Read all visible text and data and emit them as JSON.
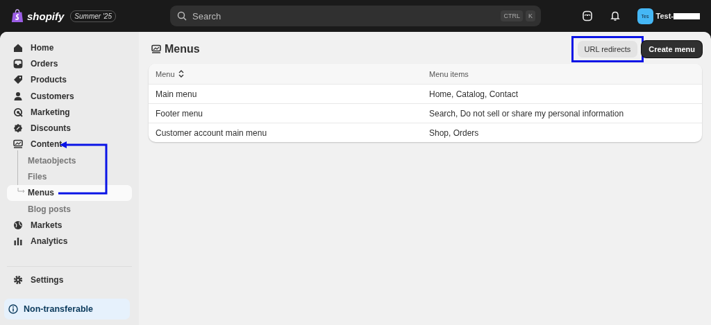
{
  "topbar": {
    "brand": "shopify",
    "edition": "Summer '25",
    "search": {
      "placeholder": "Search",
      "shortcut": [
        "CTRL",
        "K"
      ]
    },
    "avatar": "Tes",
    "user": "Test-"
  },
  "sidebar": {
    "items": [
      {
        "label": "Home",
        "selected": false
      },
      {
        "label": "Orders",
        "selected": false
      },
      {
        "label": "Products",
        "selected": false
      },
      {
        "label": "Customers",
        "selected": false
      },
      {
        "label": "Marketing",
        "selected": false
      },
      {
        "label": "Discounts",
        "selected": false
      },
      {
        "label": "Content",
        "selected": false,
        "children": [
          {
            "label": "Metaobjects",
            "selected": false
          },
          {
            "label": "Files",
            "selected": false
          },
          {
            "label": "Menus",
            "selected": true
          },
          {
            "label": "Blog posts",
            "selected": false
          }
        ]
      },
      {
        "label": "Markets",
        "selected": false
      },
      {
        "label": "Analytics",
        "selected": false
      }
    ],
    "settings": "Settings",
    "notice": "Non-transferable"
  },
  "page": {
    "title": "Menus",
    "actions": [
      {
        "label": "URL redirects",
        "kind": "secondary",
        "highlighted": true
      },
      {
        "label": "Create menu",
        "kind": "primary",
        "highlighted": false
      }
    ],
    "table": {
      "columns": [
        {
          "label": "Menu",
          "sortable": true
        },
        {
          "label": "Menu items",
          "sortable": false
        }
      ],
      "rows": [
        [
          "Main menu",
          "Home, Catalog, Contact"
        ],
        [
          "Footer menu",
          "Search, Do not sell or share my personal information"
        ],
        [
          "Customer account main menu",
          "Shop, Orders"
        ]
      ]
    }
  },
  "annotations": {
    "arrow": true
  }
}
